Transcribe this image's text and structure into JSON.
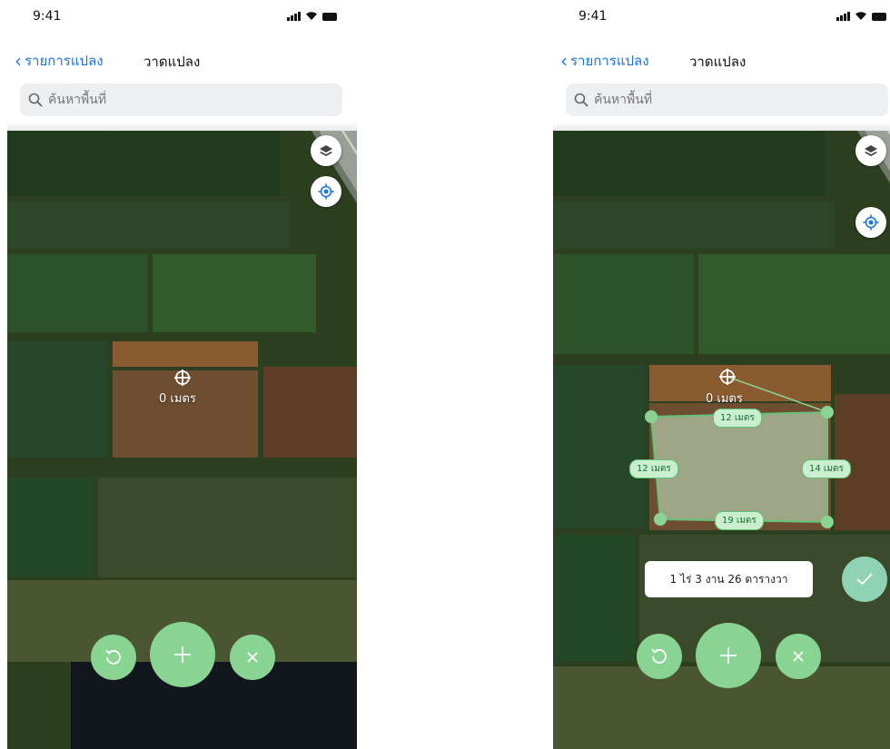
{
  "status": {
    "time": "9:41"
  },
  "nav": {
    "back_label": "รายการแปลง",
    "title": "วาดแปลง"
  },
  "search": {
    "placeholder": "ค้นหาพื้นที่"
  },
  "map": {
    "current_distance": "0 เมตร",
    "edge_labels": {
      "top": "12 เมตร",
      "left": "12 เมตร",
      "right": "14 เมตร",
      "bottom": "19 เมตร"
    },
    "area_text": "1 ไร่ 3 งาน 26 ตารางวา"
  },
  "icons": {
    "back": "chevron-left-icon",
    "search": "search-icon",
    "layers": "layers-icon",
    "locate": "my-location-icon",
    "crosshair": "crosshair-icon",
    "undo": "undo-icon",
    "add": "plus-icon",
    "cancel": "close-icon",
    "confirm": "check-icon"
  },
  "colors": {
    "accent_blue": "#1a73e8",
    "fab_green": "#8ad493",
    "polygon_fill": "#c9efcf",
    "polygon_stroke": "#66c279"
  }
}
